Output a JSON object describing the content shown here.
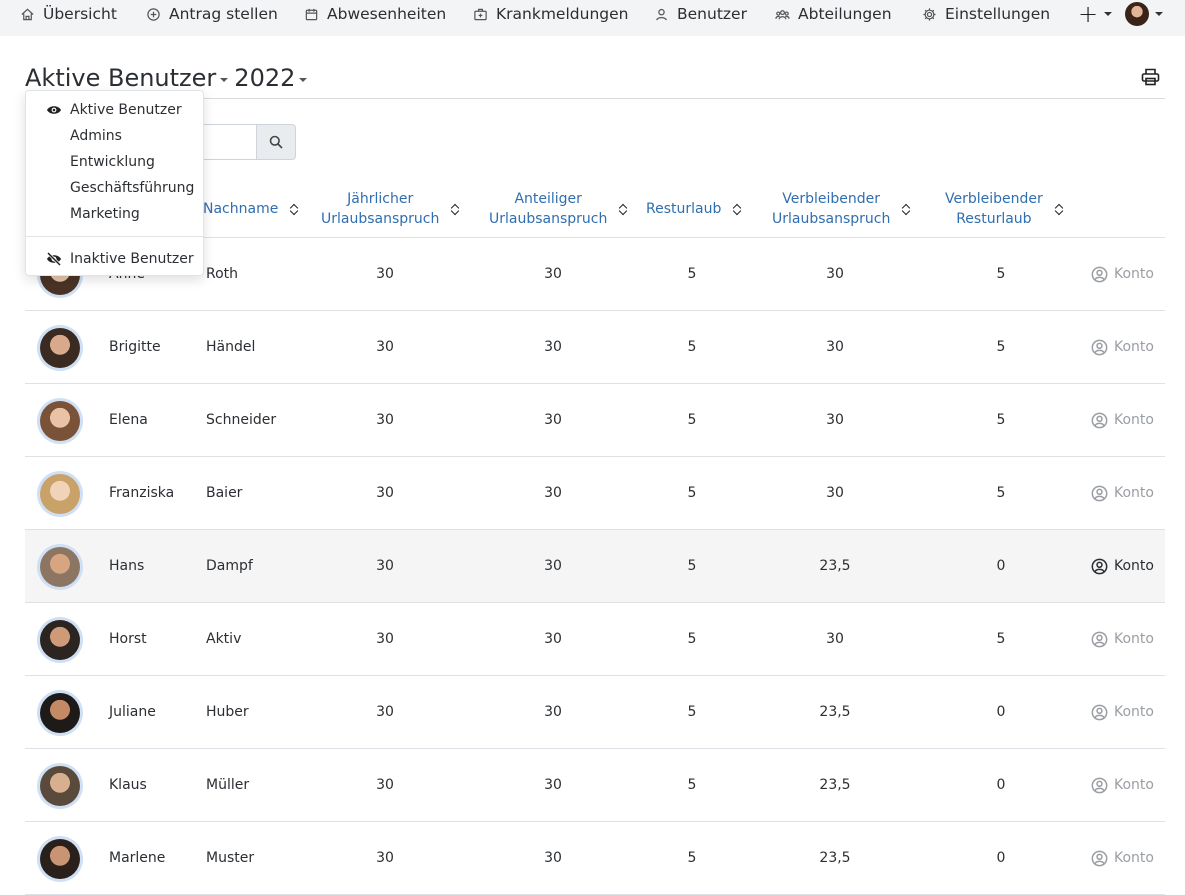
{
  "nav": {
    "items": [
      {
        "label": "Übersicht",
        "icon": "home-icon"
      },
      {
        "label": "Antrag stellen",
        "icon": "plus-circle-icon"
      },
      {
        "label": "Abwesenheiten",
        "icon": "calendar-icon"
      },
      {
        "label": "Krankmeldungen",
        "icon": "medical-bag-icon"
      },
      {
        "label": "Benutzer",
        "icon": "user-icon"
      },
      {
        "label": "Abteilungen",
        "icon": "users-group-icon"
      },
      {
        "label": "Einstellungen",
        "icon": "gear-icon"
      }
    ]
  },
  "header": {
    "view_label": "Aktive Benutzer",
    "year_label": "2022"
  },
  "search": {
    "placeholder": "",
    "value": ""
  },
  "dropdown": {
    "items": [
      "Aktive Benutzer",
      "Admins",
      "Entwicklung",
      "Geschäftsführung",
      "Marketing"
    ],
    "inactive_label": "Inaktive Benutzer"
  },
  "table": {
    "headers": {
      "nachname": "Nachname",
      "jahres_1": "Jährlicher",
      "jahres_2": "Urlaubsanspruch",
      "anteil_1": "Anteiliger",
      "anteil_2": "Urlaubsanspruch",
      "rest": "Resturlaub",
      "verb_ua_1": "Verbleibender",
      "verb_ua_2": "Urlaubsanspruch",
      "verb_rest_1": "Verbleibender",
      "verb_rest_2": "Resturlaub"
    },
    "konto_label": "Konto",
    "rows": [
      {
        "first": "Anne",
        "last": "Roth",
        "jahr": "30",
        "anteil": "30",
        "rest": "5",
        "verb_ua": "30",
        "verb_rest": "5"
      },
      {
        "first": "Brigitte",
        "last": "Händel",
        "jahr": "30",
        "anteil": "30",
        "rest": "5",
        "verb_ua": "30",
        "verb_rest": "5"
      },
      {
        "first": "Elena",
        "last": "Schneider",
        "jahr": "30",
        "anteil": "30",
        "rest": "5",
        "verb_ua": "30",
        "verb_rest": "5"
      },
      {
        "first": "Franziska",
        "last": "Baier",
        "jahr": "30",
        "anteil": "30",
        "rest": "5",
        "verb_ua": "30",
        "verb_rest": "5"
      },
      {
        "first": "Hans",
        "last": "Dampf",
        "jahr": "30",
        "anteil": "30",
        "rest": "5",
        "verb_ua": "23,5",
        "verb_rest": "0"
      },
      {
        "first": "Horst",
        "last": "Aktiv",
        "jahr": "30",
        "anteil": "30",
        "rest": "5",
        "verb_ua": "30",
        "verb_rest": "5"
      },
      {
        "first": "Juliane",
        "last": "Huber",
        "jahr": "30",
        "anteil": "30",
        "rest": "5",
        "verb_ua": "23,5",
        "verb_rest": "0"
      },
      {
        "first": "Klaus",
        "last": "Müller",
        "jahr": "30",
        "anteil": "30",
        "rest": "5",
        "verb_ua": "23,5",
        "verb_rest": "0"
      },
      {
        "first": "Marlene",
        "last": "Muster",
        "jahr": "30",
        "anteil": "30",
        "rest": "5",
        "verb_ua": "23,5",
        "verb_rest": "0"
      }
    ]
  },
  "colors": {
    "link": "#2f6eb0",
    "nav_bg": "#f3f4f5",
    "avatar_ring": "#cfe0f5",
    "muted": "#9a9ea3"
  }
}
